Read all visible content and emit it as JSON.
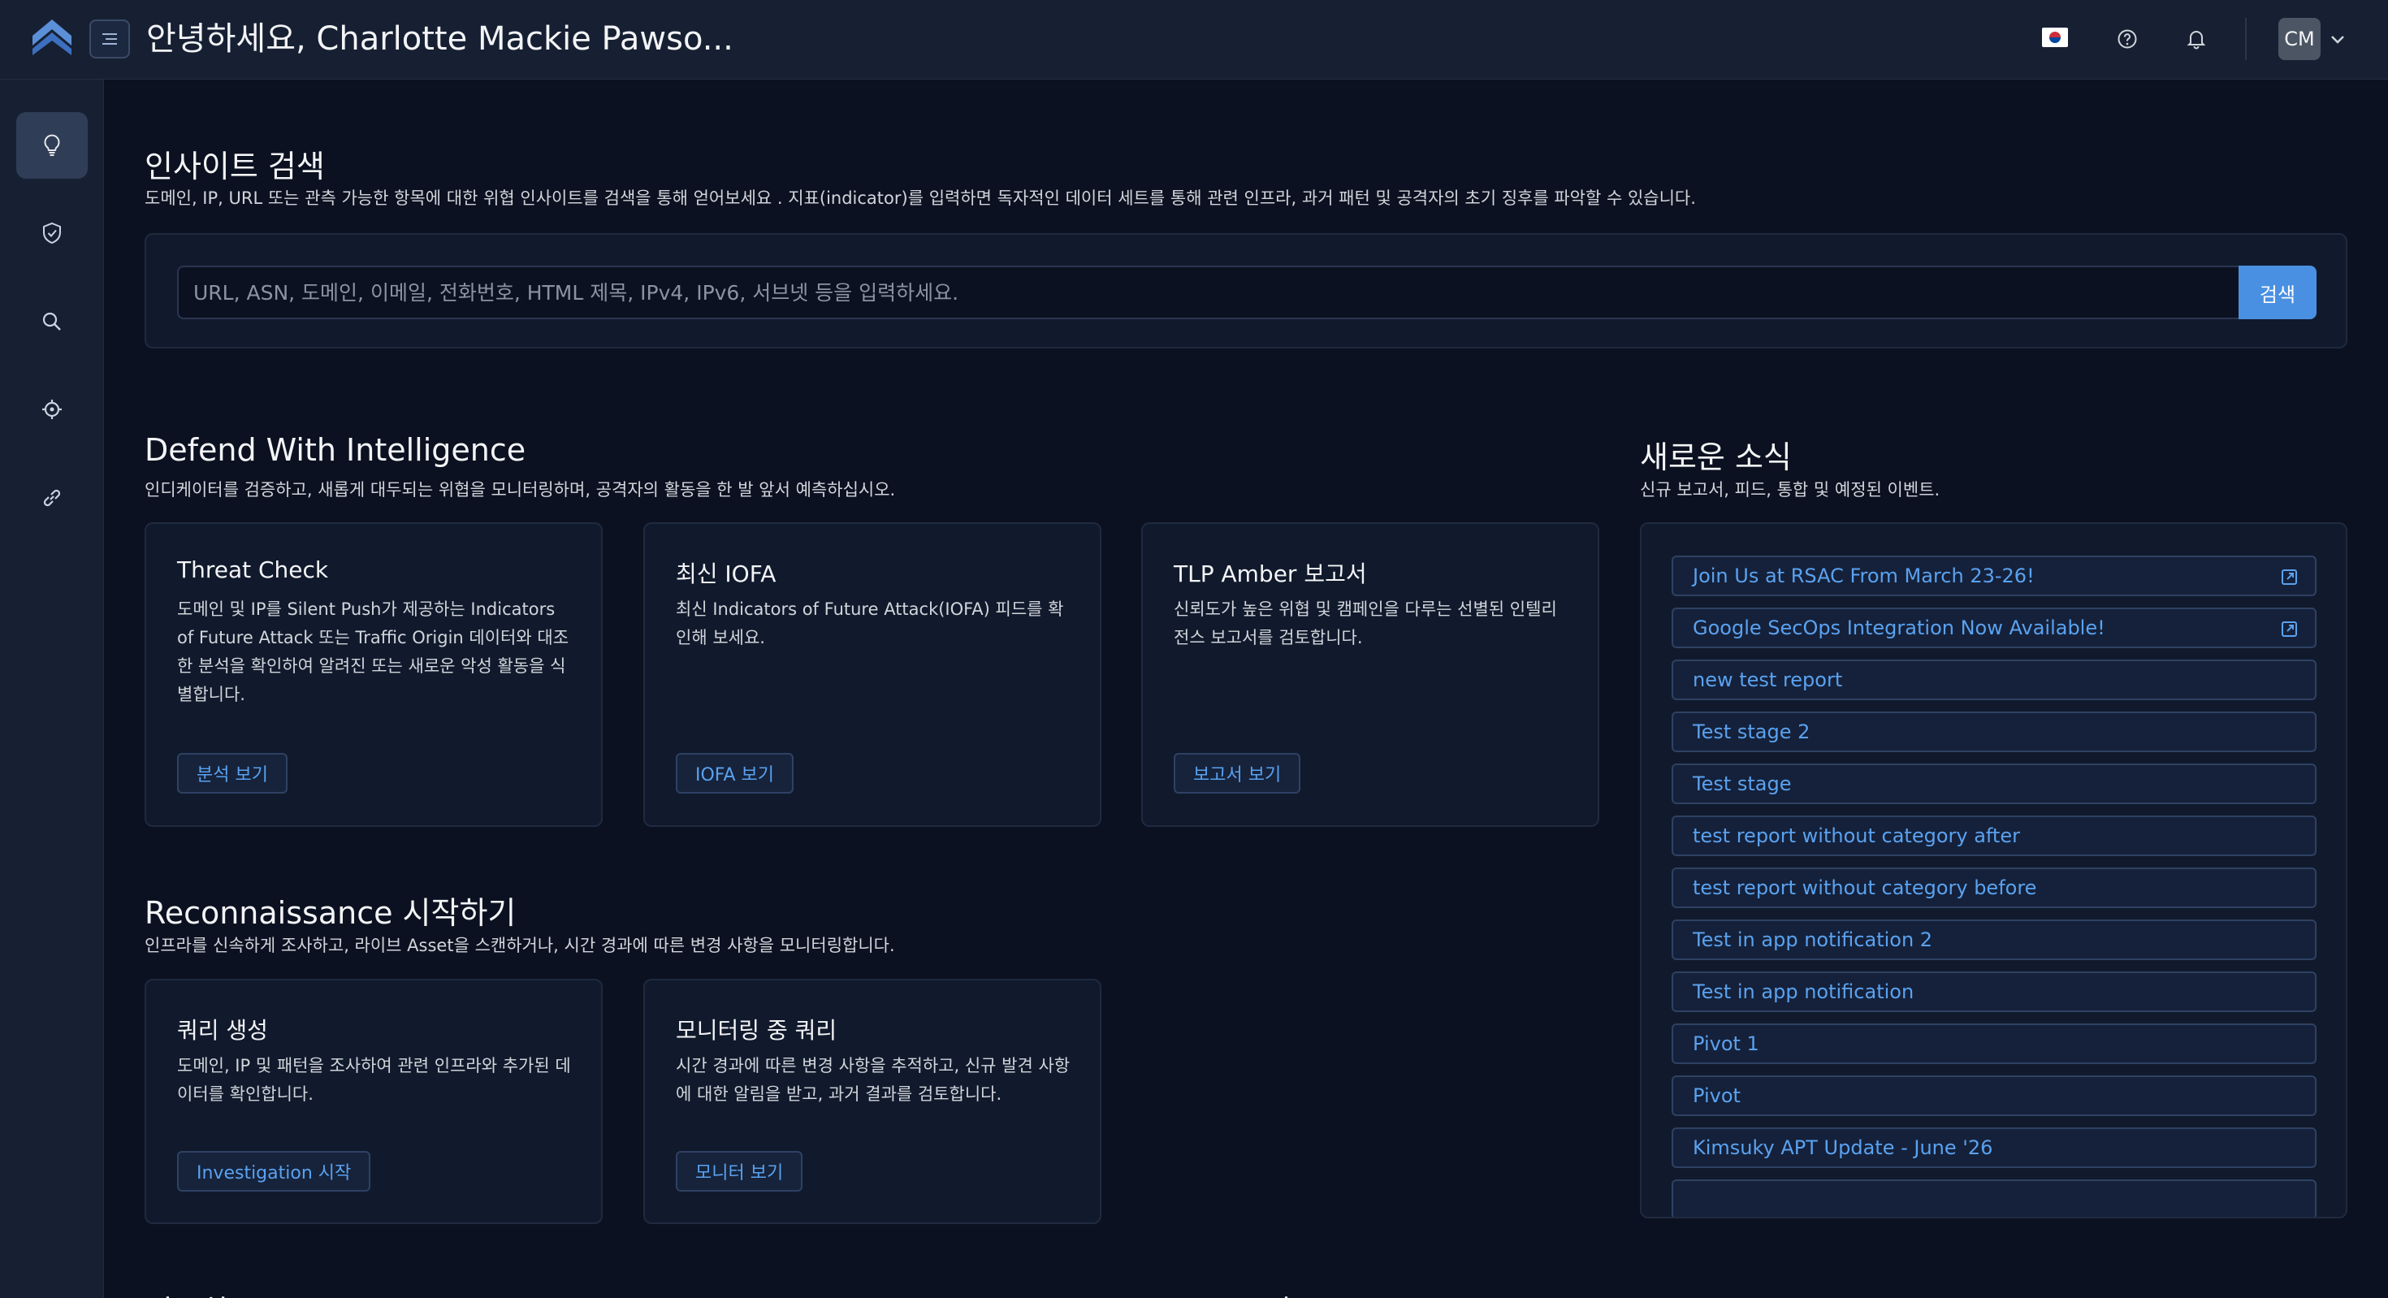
{
  "header": {
    "greeting": "안녕하세요, Charlotte Mackie Pawso...",
    "avatar_initials": "CM"
  },
  "icons": {
    "logo": "silent-push-logo",
    "menu": "menu-toggle-icon",
    "flag": "korean-flag-icon",
    "help": "help-circle-icon",
    "bell": "bell-icon",
    "caret": "chevron-down-icon",
    "external": "external-link-icon"
  },
  "sidebar": {
    "items": [
      {
        "icon": "lightbulb-icon",
        "active": true
      },
      {
        "icon": "shield-check-icon",
        "active": false
      },
      {
        "icon": "search-icon",
        "active": false
      },
      {
        "icon": "crosshair-icon",
        "active": false
      },
      {
        "icon": "link-icon",
        "active": false
      }
    ]
  },
  "insight": {
    "title": "인사이트 검색",
    "subtitle": "도메인, IP, URL 또는 관측 가능한 항목에 대한 위협 인사이트를 검색을 통해 얻어보세요 . 지표(indicator)를 입력하면 독자적인 데이터 세트를 통해 관련 인프라, 과거 패턴 및 공격자의 초기 징후를 파악할 수 있습니다.",
    "placeholder": "URL, ASN, 도메인, 이메일, 전화번호, HTML 제목, IPv4, IPv6, 서브넷 등을 입력하세요.",
    "button": "검색"
  },
  "defend": {
    "title": "Defend With Intelligence",
    "subtitle": "인디케이터를 검증하고, 새롭게 대두되는 위협을 모니터링하며, 공격자의 활동을 한 발 앞서 예측하십시오.",
    "cards": [
      {
        "title": "Threat Check",
        "desc": "도메인 및 IP를 Silent Push가 제공하는 Indicators of Future Attack 또는 Traffic Origin 데이터와 대조한 분석을 확인하여 알려진 또는 새로운 악성 활동을 식별합니다.",
        "button": "분석 보기"
      },
      {
        "title": "최신 IOFA",
        "desc": "최신 Indicators of Future Attack(IOFA) 피드를 확인해 보세요.",
        "button": "IOFA 보기"
      },
      {
        "title": "TLP Amber 보고서",
        "desc": "신뢰도가 높은 위협 및 캠페인을 다루는 선별된 인텔리전스 보고서를 검토합니다.",
        "button": "보고서 보기"
      }
    ]
  },
  "recon": {
    "title": "Reconnaissance 시작하기",
    "subtitle": "인프라를 신속하게 조사하고, 라이브 Asset을 스캔하거나, 시간 경과에 따른 변경 사항을 모니터링합니다.",
    "cards": [
      {
        "title": "쿼리 생성",
        "desc": "도메인, IP 및 패턴을 조사하여 관련 인프라와 추가된 데이터를 확인합니다.",
        "button": "Investigation 시작"
      },
      {
        "title": "모니터링 중 쿼리",
        "desc": "시간 경과에 따른 변경 사항을 추적하고, 신규 발견 사항에 대한 알림을 받고, 과거 결과를 검토합니다.",
        "button": "모니터 보기"
      }
    ]
  },
  "news": {
    "title": "새로운 소식",
    "subtitle": "신규 보고서, 피드, 통합 및 예정된 이벤트.",
    "items": [
      {
        "label": "Join Us at RSAC From March 23-26!",
        "external": true
      },
      {
        "label": "Google SecOps Integration Now Available!",
        "external": true
      },
      {
        "label": "new test report",
        "external": false
      },
      {
        "label": "Test stage 2",
        "external": false
      },
      {
        "label": "Test stage",
        "external": false
      },
      {
        "label": "test report without category after",
        "external": false
      },
      {
        "label": "test report without category before",
        "external": false
      },
      {
        "label": "Test in app notification 2",
        "external": false
      },
      {
        "label": "Test in app notification",
        "external": false
      },
      {
        "label": "Pivot 1",
        "external": false
      },
      {
        "label": "Pivot",
        "external": false
      },
      {
        "label": "Kimsuky APT Update - June '26",
        "external": false
      }
    ]
  },
  "bottom": {
    "left_title": "이동하",
    "right_title": "리소스"
  },
  "colors": {
    "background": "#0b1120",
    "panel": "#111a2c",
    "header": "#172033",
    "accent": "#4a90e2",
    "link": "#5aa2f0"
  }
}
